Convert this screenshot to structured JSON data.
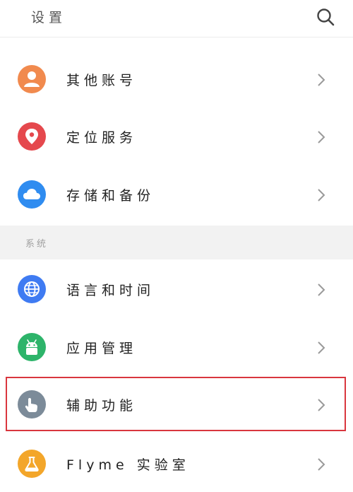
{
  "header": {
    "title": "设置",
    "search_icon": "search-icon"
  },
  "account_items": [
    {
      "label": "其他账号",
      "icon": "person-icon",
      "color": "#F18A4E"
    },
    {
      "label": "定位服务",
      "icon": "location-pin-icon",
      "color": "#E5484D"
    },
    {
      "label": "存储和备份",
      "icon": "cloud-icon",
      "color": "#2F8CF0"
    }
  ],
  "section": {
    "label": "系统"
  },
  "system_items": [
    {
      "label": "语言和时间",
      "icon": "globe-icon",
      "color": "#3F7BF2"
    },
    {
      "label": "应用管理",
      "icon": "android-icon",
      "color": "#2DB46A"
    },
    {
      "label": "辅助功能",
      "icon": "hand-pointer-icon",
      "color": "#7C8B99",
      "highlighted": true
    },
    {
      "label": "Flyme 实验室",
      "icon": "flask-icon",
      "color": "#F3A62A"
    }
  ],
  "colors": {
    "highlight": "#D9363E",
    "chevron": "#9a9a9a"
  }
}
